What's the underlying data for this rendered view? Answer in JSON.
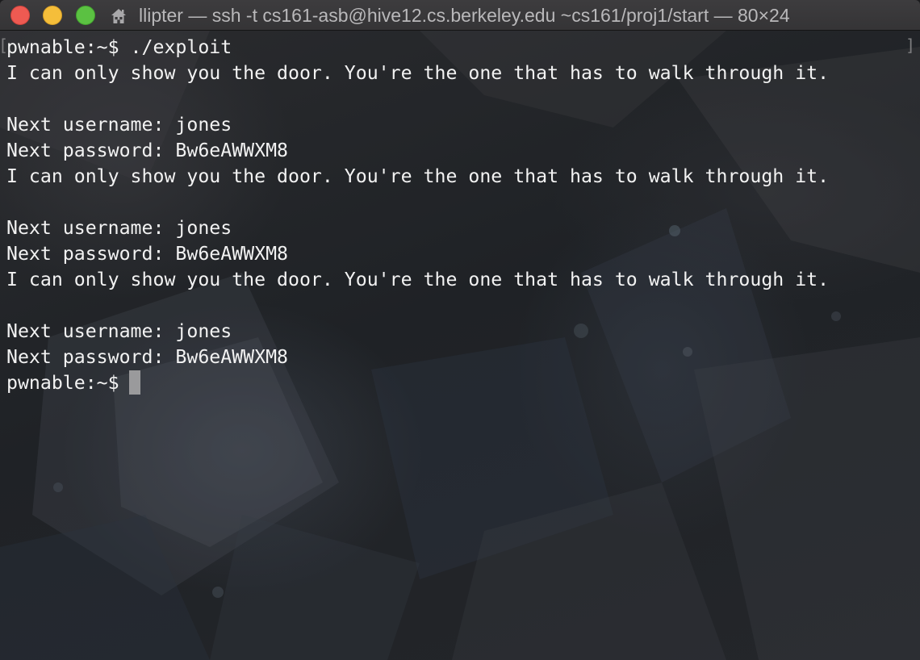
{
  "window": {
    "title": "llipter — ssh -t cs161-asb@hive12.cs.berkeley.edu ~cs161/proj1/start — 80×24",
    "controls": {
      "close": "close-button",
      "minimize": "minimize-button",
      "zoom": "zoom-button"
    },
    "title_icon": "home-folder-icon"
  },
  "terminal": {
    "lines": [
      "pwnable:~$ ./exploit",
      "I can only show you the door. You're the one that has to walk through it.",
      "",
      "Next username: jones",
      "Next password: Bw6eAWWXM8",
      "I can only show you the door. You're the one that has to walk through it.",
      "",
      "Next username: jones",
      "Next password: Bw6eAWWXM8",
      "I can only show you the door. You're the one that has to walk through it.",
      "",
      "Next username: jones",
      "Next password: Bw6eAWWXM8"
    ],
    "prompt": "pwnable:~$"
  },
  "colors": {
    "close": "#ee5a52",
    "minimize": "#f5be3a",
    "zoom": "#5bc142",
    "text": "#f2f2f2",
    "cursor": "#9a9a9c"
  }
}
